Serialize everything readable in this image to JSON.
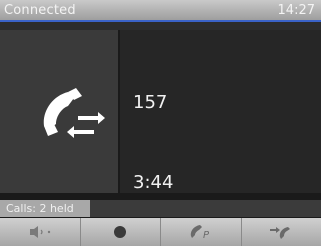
{
  "status": {
    "text": "Connected",
    "time": "14:27"
  },
  "call": {
    "number": "157",
    "duration": "3:44"
  },
  "calls_info": "Calls: 2 held",
  "softkeys": [
    {
      "icon": "speaker-volume-icon",
      "label": "🔈·"
    },
    {
      "icon": "record-icon",
      "label": ""
    },
    {
      "icon": "call-park-icon",
      "label": ""
    },
    {
      "icon": "call-transfer-icon",
      "label": ""
    }
  ],
  "colors": {
    "accent": "#3b63c8",
    "background": "#262626",
    "status_bar": "#b5b5b5"
  }
}
